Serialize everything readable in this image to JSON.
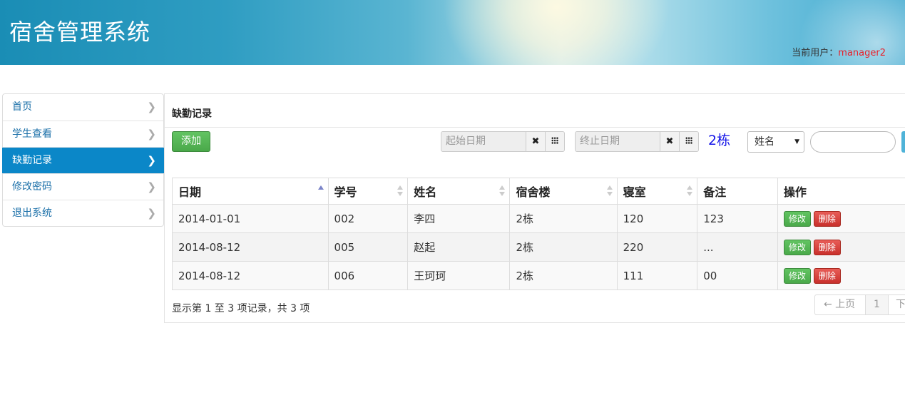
{
  "header": {
    "title": "宿舍管理系统",
    "current_user_label": "当前用户：",
    "current_user": "manager2"
  },
  "sidebar": {
    "items": [
      {
        "label": "首页",
        "active": false
      },
      {
        "label": "学生查看",
        "active": false
      },
      {
        "label": "缺勤记录",
        "active": true
      },
      {
        "label": "修改密码",
        "active": false
      },
      {
        "label": "退出系统",
        "active": false
      }
    ]
  },
  "main": {
    "title": "缺勤记录",
    "add_label": "添加",
    "start_date_placeholder": "起始日期",
    "end_date_placeholder": "终止日期",
    "building": "2栋",
    "search_field_selected": "姓名",
    "search_value": ""
  },
  "table": {
    "columns": [
      "日期",
      "学号",
      "姓名",
      "宿舍楼",
      "寝室",
      "备注",
      "操作"
    ],
    "rows": [
      [
        "2014-01-01",
        "002",
        "李四",
        "2栋",
        "120",
        "123"
      ],
      [
        "2014-08-12",
        "005",
        "赵起",
        "2栋",
        "220",
        "..."
      ],
      [
        "2014-08-12",
        "006",
        "王珂珂",
        "2栋",
        "111",
        "00"
      ]
    ],
    "edit_label": "修改",
    "delete_label": "删除"
  },
  "footer": {
    "info": "显示第 1 至 3 项记录，共 3 项",
    "prev_label": "← 上页",
    "page": "1",
    "next_label": "下"
  },
  "colors": {
    "accent": "#0b87c8",
    "user_name": "#e8202a",
    "building_text": "#1515e8",
    "add_button": "#4aa94a",
    "delete_button": "#c9302c"
  }
}
